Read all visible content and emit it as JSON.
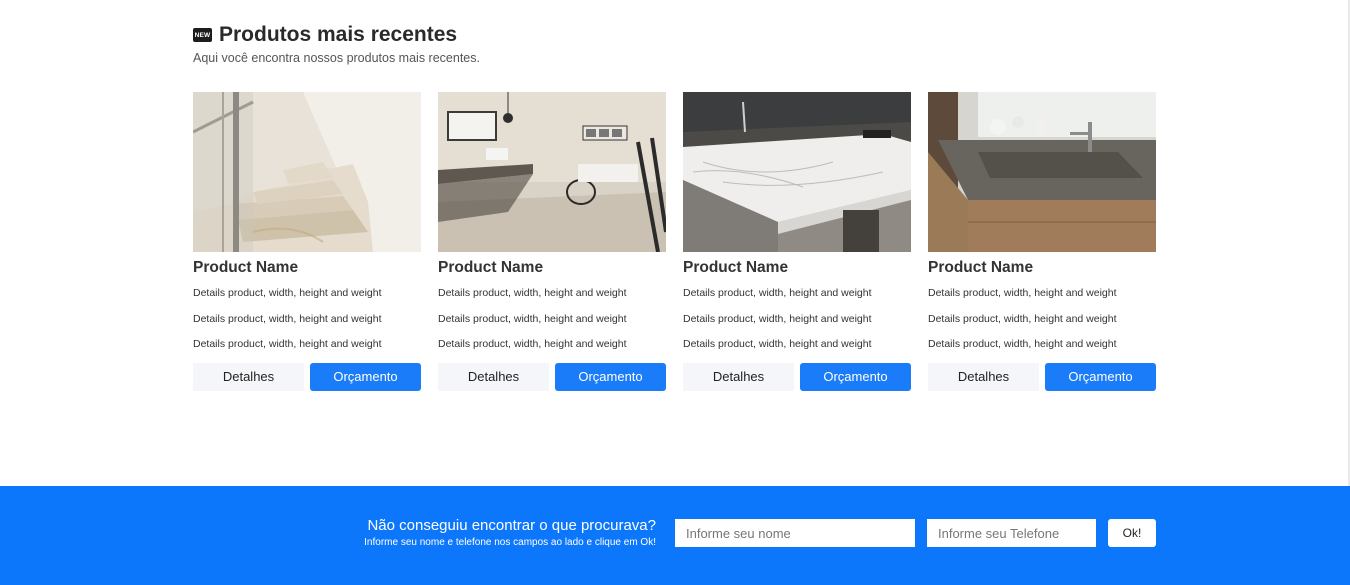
{
  "section": {
    "badge_icon": "new-badge-icon",
    "badge_text": "NEW",
    "title": "Produtos mais recentes",
    "subtitle": "Aqui você encontra nossos produtos mais recentes."
  },
  "products": [
    {
      "image": "staircase-marble-photo",
      "name": "Product Name",
      "details": [
        "Details product, width, height and weight",
        "Details product, width, height and weight",
        "Details product, width, height and weight"
      ],
      "details_label": "Detalhes",
      "quote_label": "Orçamento"
    },
    {
      "image": "bathroom-photo",
      "name": "Product Name",
      "details": [
        "Details product, width, height and weight",
        "Details product, width, height and weight",
        "Details product, width, height and weight"
      ],
      "details_label": "Detalhes",
      "quote_label": "Orçamento"
    },
    {
      "image": "kitchen-countertop-photo",
      "name": "Product Name",
      "details": [
        "Details product, width, height and weight",
        "Details product, width, height and weight",
        "Details product, width, height and weight"
      ],
      "details_label": "Detalhes",
      "quote_label": "Orçamento"
    },
    {
      "image": "vanity-sink-photo",
      "name": "Product Name",
      "details": [
        "Details product, width, height and weight",
        "Details product, width, height and weight",
        "Details product, width, height and weight"
      ],
      "details_label": "Detalhes",
      "quote_label": "Orçamento"
    }
  ],
  "footer": {
    "heading": "Não conseguiu encontrar o que procurava?",
    "subtext": "Informe seu nome e telefone nos campos ao lado e clique em Ok!",
    "name_placeholder": "Informe seu nome",
    "phone_placeholder": "Informe seu Telefone",
    "ok_label": "Ok!"
  },
  "colors": {
    "accent": "#0d77fb",
    "quote_button": "#1a7cf8",
    "details_button": "#f4f6f9"
  }
}
